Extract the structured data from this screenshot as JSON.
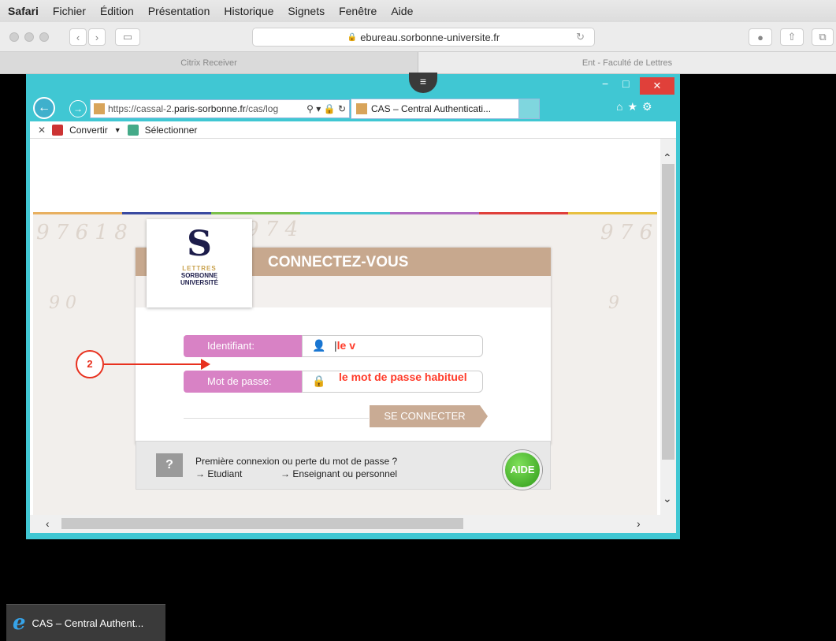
{
  "menubar": {
    "items": [
      "Safari",
      "Fichier",
      "Édition",
      "Présentation",
      "Historique",
      "Signets",
      "Fenêtre",
      "Aide"
    ]
  },
  "safari": {
    "address": "ebureau.sorbonne-universite.fr",
    "tabs": [
      "Citrix Receiver",
      "Ent - Faculté de Lettres"
    ]
  },
  "ie": {
    "url_prefix": "https://cassal-2.",
    "url_domain": "paris-sorbonne.fr",
    "url_suffix": "/cas/log",
    "tab_title": "CAS – Central Authenticati...",
    "cmd_convert": "Convertir",
    "cmd_select": "Sélectionner"
  },
  "login": {
    "logo_line1": "LETTRES",
    "logo_line2": "SORBONNE",
    "logo_line3": "UNIVERSITÉ",
    "title": "CONNECTEZ-VOUS",
    "identifiant_label": "Identifiant:",
    "identifiant_value": "le v",
    "password_label": "Mot de passe:",
    "password_hint": "le mot de passe habituel",
    "submit_label": "SE CONNECTER",
    "help_question": "Première connexion ou perte du mot de passe ?",
    "link_student": "→ Etudiant",
    "link_staff": "→ Enseignant ou personnel",
    "help_button": "AIDE",
    "help_box": "?"
  },
  "annotation": {
    "step_number": "2"
  },
  "taskbar": {
    "item": "CAS – Central Authent..."
  },
  "colors": {
    "accent_pink": "#d882c5",
    "brand_tan": "#c7a88e",
    "annotation_red": "#e8311f",
    "citrix_teal": "#40c7d3"
  }
}
